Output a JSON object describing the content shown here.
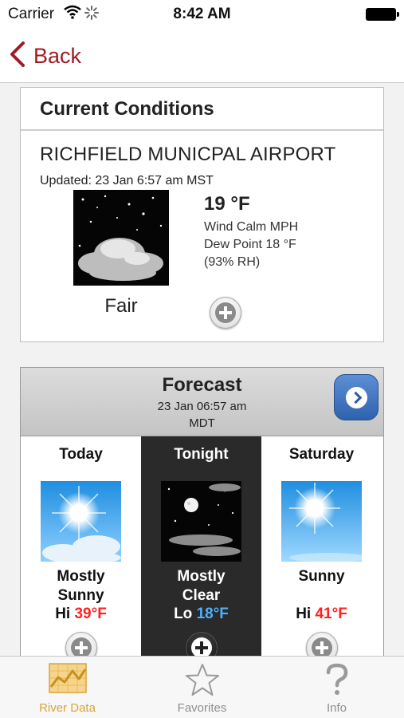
{
  "status_bar": {
    "carrier": "Carrier",
    "time": "8:42 AM"
  },
  "nav": {
    "back_label": "Back"
  },
  "current": {
    "heading": "Current Conditions",
    "station": "RICHFIELD MUNICPAL AIRPORT",
    "updated": "Updated: 23 Jan 6:57 am MST",
    "temperature": "19 °F",
    "wind": "Wind Calm MPH",
    "dew_point": "Dew Point 18 °F",
    "humidity": "(93% RH)",
    "condition": "Fair",
    "icon": "night-fair-icon"
  },
  "forecast": {
    "title": "Forecast",
    "issued_line1": "23 Jan 06:57 am",
    "issued_line2": "MDT",
    "periods": [
      {
        "name": "Today",
        "cond_line1": "Mostly",
        "cond_line2": "Sunny",
        "temp_label": "Hi",
        "temp_value": "39°F",
        "temp_color": "#ff2020",
        "icon": "mostly-sunny-icon"
      },
      {
        "name": "Tonight",
        "cond_line1": "Mostly",
        "cond_line2": "Clear",
        "temp_label": "Lo",
        "temp_value": "18°F",
        "temp_color": "#4db0ff",
        "icon": "mostly-clear-night-icon"
      },
      {
        "name": "Saturday",
        "cond_line1": "Sunny",
        "cond_line2": "",
        "temp_label": "Hi",
        "temp_value": "41°F",
        "temp_color": "#ff2020",
        "icon": "sunny-icon"
      }
    ]
  },
  "tabs": [
    {
      "label": "River Data",
      "icon": "river-chart-icon",
      "active": true
    },
    {
      "label": "Favorites",
      "icon": "star-icon",
      "active": false
    },
    {
      "label": "Info",
      "icon": "question-mark-icon",
      "active": false
    }
  ],
  "colors": {
    "accent": "#a01c22",
    "tab_active": "#d9a43a",
    "hi_temp": "#ff2020",
    "lo_temp": "#4db0ff"
  }
}
